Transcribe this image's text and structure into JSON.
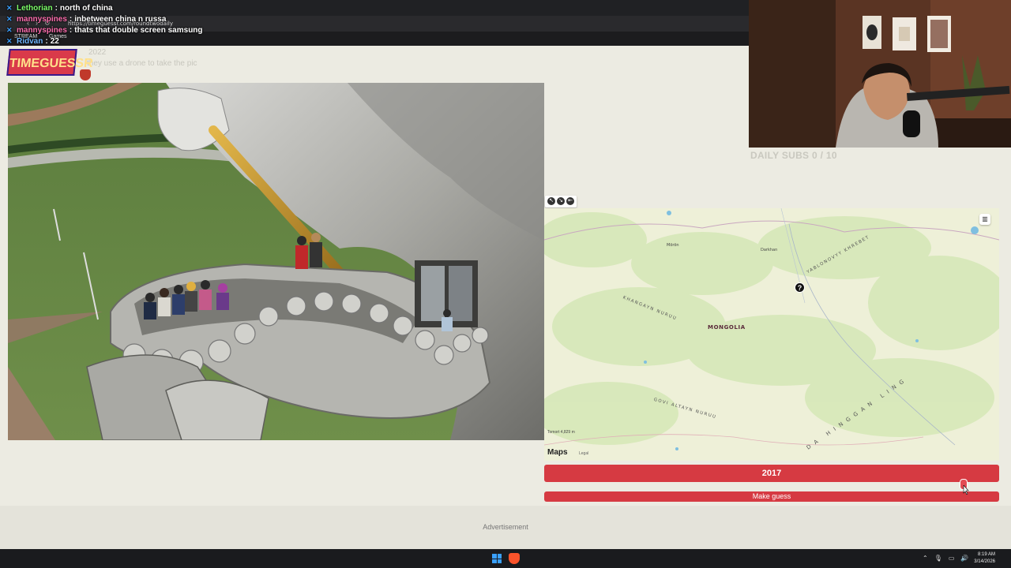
{
  "browser": {
    "url": "https://timeguessr.com/roundtwodaily",
    "bookmarks": [
      "STREAM",
      "Games"
    ]
  },
  "chat": [
    {
      "user": "Lethorian",
      "message": "north of china"
    },
    {
      "user": "mannyspines",
      "message": "inbetween china n russa"
    },
    {
      "user": "mannyspines",
      "message": "thats that double screen samsung"
    },
    {
      "user": "Ridvan",
      "message": "22"
    }
  ],
  "overlay": {
    "logo_text": "TIMEGUESSR",
    "ghost_lines": [
      "2022",
      "they use a drone to take the pic"
    ]
  },
  "webcam": {
    "daily_subs": "DAILY SUBS 0 / 10"
  },
  "map": {
    "country_label": "MONGOLIA",
    "ranges": [
      "KHANGAYN NURUU",
      "GOVI ALTAYN NURUU",
      "YABLONOVYY KHREBET",
      "DA HINGGAN LING"
    ],
    "cities": [
      "Mörön",
      "Darkhan"
    ],
    "brand": "Maps",
    "legal": "Legal",
    "scale": "Tomort 4,829 m",
    "pin_icon": "map-pin"
  },
  "game": {
    "year_value": "2017",
    "guess_button": "Make guess"
  },
  "ad": {
    "label": "Advertisement"
  },
  "taskbar": {
    "time": "8:19 AM",
    "date": "3/14/2026"
  },
  "colors": {
    "accent": "#d63a42",
    "background": "#ecebe2"
  }
}
